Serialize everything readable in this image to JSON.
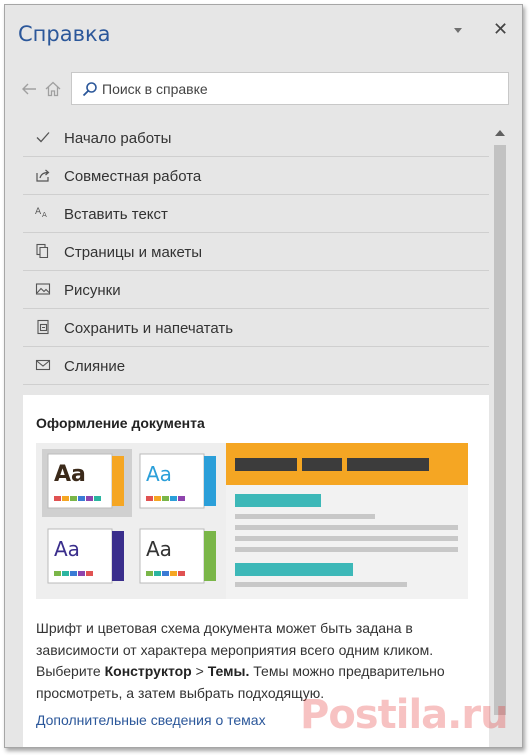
{
  "pane": {
    "title": "Справка",
    "options_icon": "chevron-down-icon",
    "close_glyph": "✕"
  },
  "nav": {
    "back_icon": "back-arrow-icon",
    "home_icon": "home-icon"
  },
  "search": {
    "placeholder": "Поиск в справке",
    "value": ""
  },
  "topics": [
    {
      "label": "Начало работы",
      "icon": "checkmark-icon"
    },
    {
      "label": "Совместная работа",
      "icon": "share-icon"
    },
    {
      "label": "Вставить текст",
      "icon": "text-size-icon"
    },
    {
      "label": "Страницы и макеты",
      "icon": "pages-icon"
    },
    {
      "label": "Рисунки",
      "icon": "picture-icon"
    },
    {
      "label": "Сохранить и напечатать",
      "icon": "print-icon"
    },
    {
      "label": "Слияние",
      "icon": "mail-icon"
    }
  ],
  "card": {
    "title": "Оформление документа",
    "text_1": "Шрифт и цветовая схема документа может быть задана в зависимости от характера мероприятия всего одним кликом. Выберите ",
    "bold_1": "Конструктор",
    "text_2": " > ",
    "bold_2": "Темы.",
    "text_3": " Темы можно предварительно просмотреть, а затем выбрать подходящую.",
    "link": "Дополнительные сведения о темах",
    "theme_sample": "Aa",
    "colors": {
      "accent_orange": "#f5a623",
      "accent_blue": "#2b9fd9",
      "accent_purple": "#3a2e8c",
      "accent_green": "#7ab648",
      "teal_bar": "#3db8b8",
      "dark_bar": "#3c3c3c"
    }
  },
  "watermark": "Postila.ru",
  "colors": {
    "title_blue": "#2b579a",
    "pane_bg": "#e6e6e6"
  }
}
